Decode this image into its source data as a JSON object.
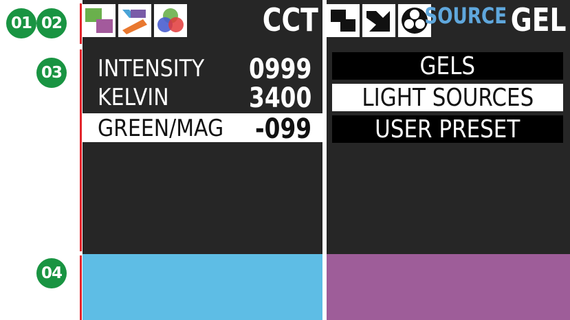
{
  "callouts": [
    "01",
    "02",
    "03",
    "04"
  ],
  "colors": {
    "callout_green": "#199442",
    "accent_red": "#e2232a",
    "panel_bg": "#262626",
    "source_blue": "#5fa7dc",
    "cct_swatch": "#5ebde5",
    "gel_swatch": "#9e5d99"
  },
  "left_screen": {
    "mode_label": "CCT",
    "mode_icons": [
      "cct-mode-icon",
      "source-mode-icon",
      "rgb-mode-icon"
    ],
    "params": [
      {
        "label": "INTENSITY",
        "value": "0999"
      },
      {
        "label": "KELVIN",
        "value": "3400"
      },
      {
        "label": "GREEN/MAG",
        "value": "-099"
      }
    ],
    "selected_param": "GREEN/MAG"
  },
  "right_screen": {
    "mode_prefix": "SOURCE",
    "mode_label": "GEL",
    "mode_icons": [
      "cct-mode-icon",
      "source-mode-icon",
      "rgb-mode-icon"
    ],
    "menu": [
      "GELS",
      "LIGHT SOURCES",
      "USER PRESET"
    ],
    "selected_menu": "LIGHT SOURCES"
  }
}
